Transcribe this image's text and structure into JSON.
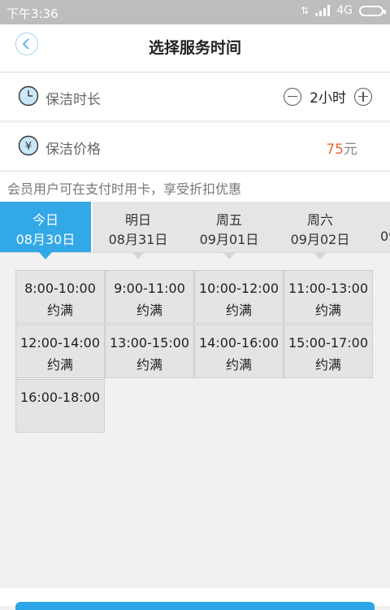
{
  "status_bar": {
    "time": "下午3:36",
    "network": "4G"
  },
  "header": {
    "title": "选择服务时间"
  },
  "duration": {
    "label": "保洁时长",
    "value": "2小时"
  },
  "price": {
    "label": "保洁价格",
    "amount": "75",
    "unit": "元"
  },
  "notice": "会员用户可在支付时用卡，享受折扣优惠",
  "date_tabs": [
    {
      "day": "今日",
      "date": "08月30日",
      "active": true
    },
    {
      "day": "明日",
      "date": "08月31日",
      "active": false
    },
    {
      "day": "周五",
      "date": "09月01日",
      "active": false
    },
    {
      "day": "周六",
      "date": "09月02日",
      "active": false
    },
    {
      "day": "",
      "date": "09",
      "active": false
    }
  ],
  "slots": [
    {
      "time": "8:00-10:00",
      "status": "约满"
    },
    {
      "time": "9:00-11:00",
      "status": "约满"
    },
    {
      "time": "10:00-12:00",
      "status": "约满"
    },
    {
      "time": "11:00-13:00",
      "status": "约满"
    },
    {
      "time": "12:00-14:00",
      "status": "约满"
    },
    {
      "time": "13:00-15:00",
      "status": "约满"
    },
    {
      "time": "14:00-16:00",
      "status": "约满"
    },
    {
      "time": "15:00-17:00",
      "status": "约满"
    },
    {
      "time": "16:00-18:00",
      "status": ""
    }
  ],
  "colors": {
    "accent": "#33a8e6",
    "price": "#e36a2e"
  },
  "icons": {
    "back": "back-chevron-icon",
    "duration": "clock-icon",
    "price": "yen-coin-icon",
    "minus": "minus-circle-icon",
    "plus": "plus-circle-icon"
  }
}
